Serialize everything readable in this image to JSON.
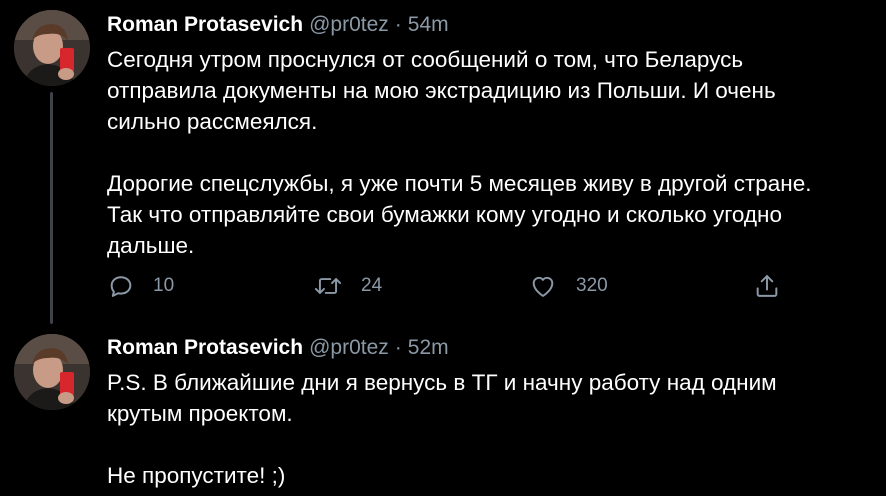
{
  "tweets": [
    {
      "author_name": "Roman Protasevich",
      "handle": "@pr0tez",
      "separator": "·",
      "time": "54m",
      "text": "Сегодня утром проснулся от сообщений о том, что Беларусь\nотправила документы на мою экстрадицию из Польши. И очень\nсильно рассмеялся.\n\nДорогие спецслужбы, я уже почти 5 месяцев живу в другой стране.\nТак что отправляйте свои бумажки кому угодно и сколько угодно\nдальше.",
      "replies": "10",
      "retweets": "24",
      "likes": "320"
    },
    {
      "author_name": "Roman Protasevich",
      "handle": "@pr0tez",
      "separator": "·",
      "time": "52m",
      "text": "P.S. В ближайшие дни я вернусь в ТГ и начну работу над одним\nкрутым проектом.\n\nНе пропустите! ;)"
    }
  ],
  "icons": {
    "reply": "reply-icon",
    "retweet": "retweet-icon",
    "like": "heart-icon",
    "share": "share-icon"
  },
  "colors": {
    "background": "#000000",
    "text": "#ffffff",
    "secondary": "#8b98a5",
    "thread_line": "#3d4349"
  }
}
